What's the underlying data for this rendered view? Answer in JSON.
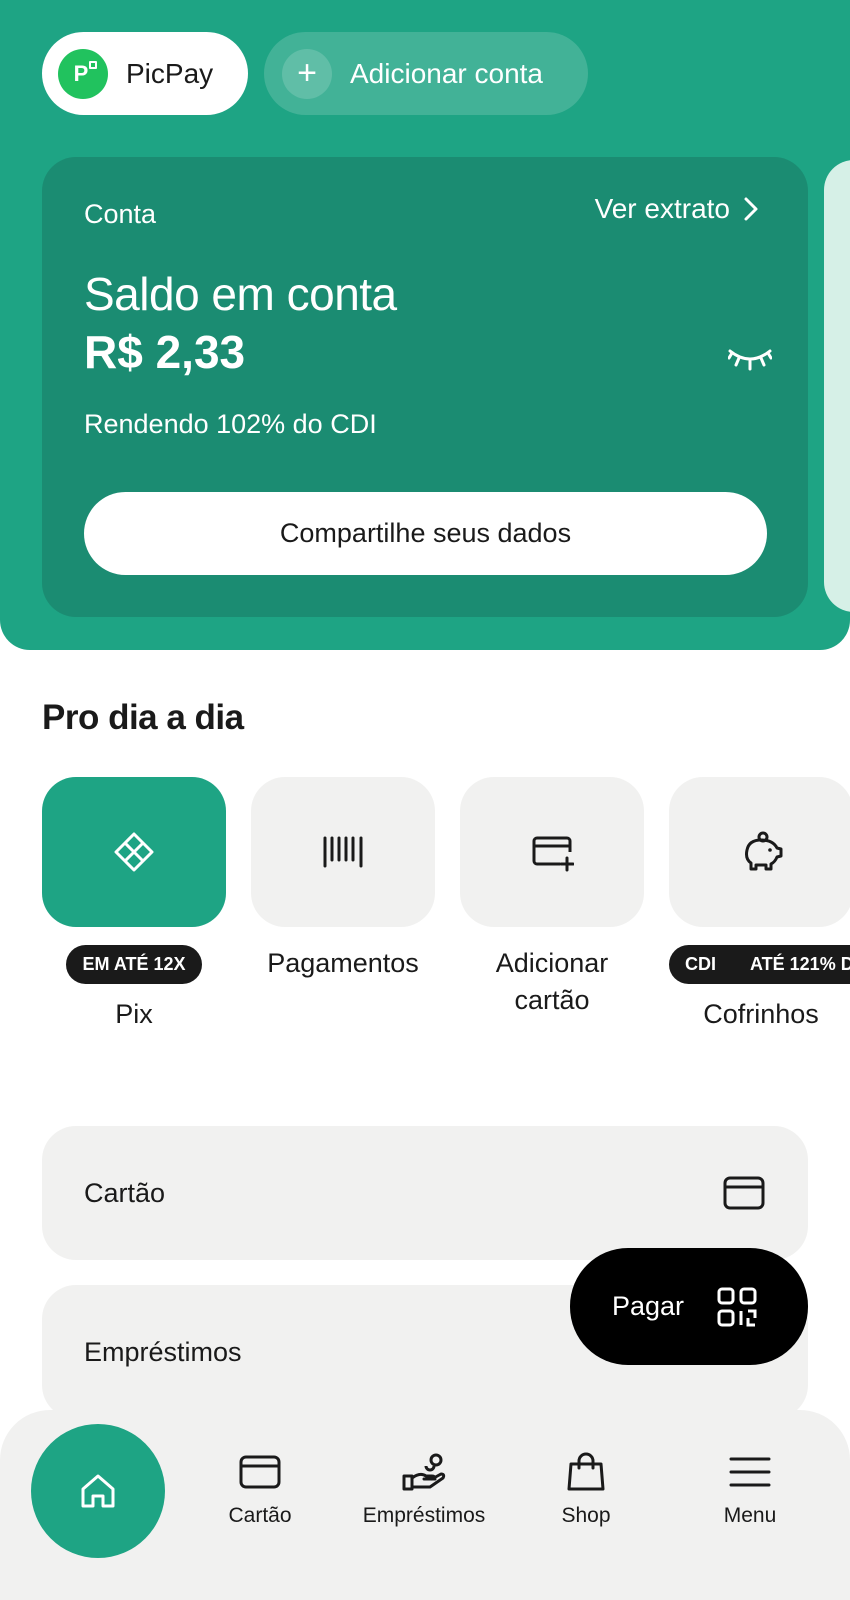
{
  "accounts": {
    "active_label": "PicPay",
    "add_label": "Adicionar conta"
  },
  "account_card": {
    "title": "Conta",
    "statement_link": "Ver extrato",
    "balance_label": "Saldo em conta",
    "balance_value": "R$ 2,33",
    "yield_text": "Rendendo 102% do CDI",
    "share_button": "Compartilhe seus dados"
  },
  "daily": {
    "title": "Pro dia a dia",
    "shortcuts": [
      {
        "label": "Pix",
        "badge": "EM ATÉ 12X",
        "icon": "pix-icon"
      },
      {
        "label": "Pagamentos",
        "icon": "barcode-icon"
      },
      {
        "label_line1": "Adicionar",
        "label_line2": "cartão",
        "icon": "add-card-icon"
      },
      {
        "label": "Cofrinhos",
        "badge_part1": "CDI",
        "badge_part2": "ATÉ 121% D",
        "icon": "piggy-bank-icon"
      }
    ]
  },
  "list": {
    "card": "Cartão",
    "loans": "Empréstimos"
  },
  "pay_fab": {
    "label": "Pagar",
    "icon": "qr-code-icon"
  },
  "nav": {
    "home_icon": "home-icon",
    "items": [
      {
        "label": "Cartão",
        "icon": "card-icon"
      },
      {
        "label": "Empréstimos",
        "icon": "loan-hand-icon"
      },
      {
        "label": "Shop",
        "icon": "shopping-bag-icon"
      },
      {
        "label": "Menu",
        "icon": "menu-icon"
      }
    ]
  },
  "colors": {
    "brand_green": "#1ea484",
    "card_green": "#1b8c72",
    "picpay_logo": "#21c25e",
    "tile_gray": "#f1f1f0"
  }
}
